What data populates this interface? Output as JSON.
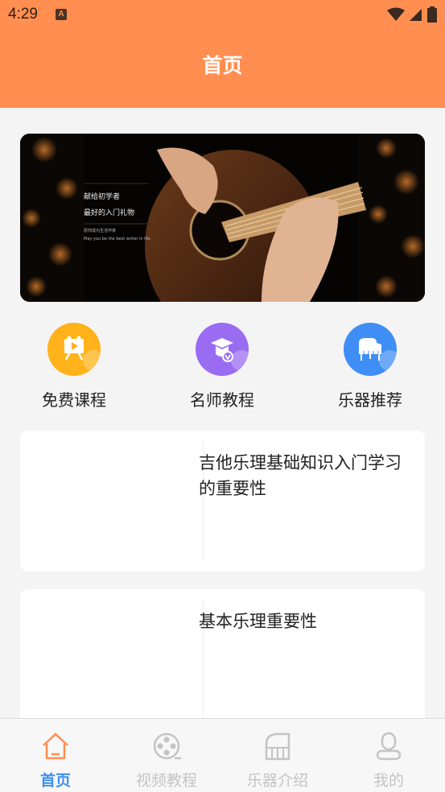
{
  "status": {
    "time": "4:29",
    "badge": "A"
  },
  "header": {
    "title": "首页"
  },
  "banner": {
    "line1": "献给初学者",
    "line2": "最好的入门礼物",
    "small1": "愿你成为生活作家",
    "small2": "May you be the best writer in life"
  },
  "quick": [
    {
      "label": "免费课程",
      "icon": "video-course-icon",
      "color": "#ffb21a"
    },
    {
      "label": "名师教程",
      "icon": "teacher-icon",
      "color": "#9a6cf2"
    },
    {
      "label": "乐器推荐",
      "icon": "piano-icon",
      "color": "#3f8ef5"
    }
  ],
  "articles": [
    {
      "title": "吉他乐理基础知识入门学习的重要性"
    },
    {
      "title": "基本乐理重要性"
    }
  ],
  "tabs": [
    {
      "label": "首页",
      "icon": "home-icon",
      "active": true
    },
    {
      "label": "视频教程",
      "icon": "film-reel-icon",
      "active": false
    },
    {
      "label": "乐器介绍",
      "icon": "piano-keys-icon",
      "active": false
    },
    {
      "label": "我的",
      "icon": "profile-icon",
      "active": false
    }
  ],
  "colors": {
    "accent": "#ff8e50",
    "tab_active": "#3b8ff0",
    "tab_inactive": "#c4c4c4"
  }
}
